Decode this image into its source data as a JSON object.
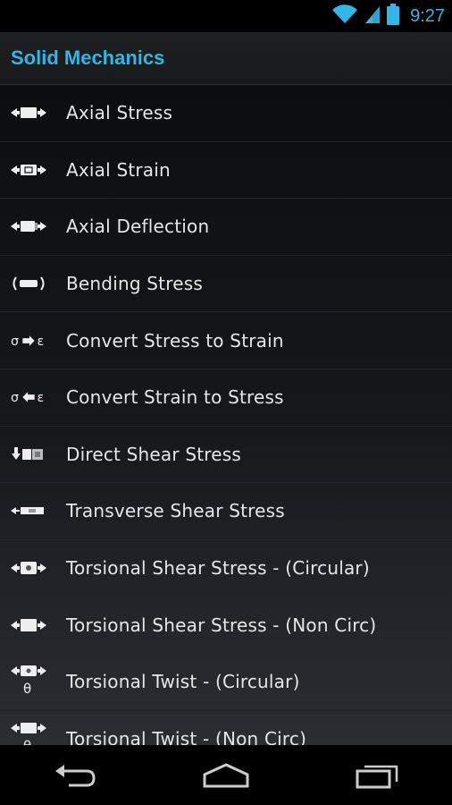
{
  "status": {
    "time": "9:27",
    "icons": [
      "wifi-icon",
      "cell-signal-icon",
      "battery-icon"
    ]
  },
  "app": {
    "title": "Solid Mechanics",
    "accent": "#33b5e5"
  },
  "list": [
    {
      "label": "Axial Stress",
      "icon": "axial-stress-icon"
    },
    {
      "label": "Axial Strain",
      "icon": "axial-strain-icon"
    },
    {
      "label": "Axial Deflection",
      "icon": "axial-deflection-icon"
    },
    {
      "label": "Bending Stress",
      "icon": "bending-stress-icon"
    },
    {
      "label": "Convert Stress to Strain",
      "icon": "stress-to-strain-icon",
      "glyph": "σ➔ε"
    },
    {
      "label": "Convert Strain to Stress",
      "icon": "strain-to-stress-icon",
      "glyph": "σ⬅ε"
    },
    {
      "label": "Direct Shear Stress",
      "icon": "direct-shear-icon"
    },
    {
      "label": "Transverse Shear Stress",
      "icon": "transverse-shear-icon"
    },
    {
      "label": "Torsional Shear Stress - (Circular)",
      "icon": "torsional-shear-circular-icon"
    },
    {
      "label": "Torsional Shear Stress - (Non Circ)",
      "icon": "torsional-shear-noncirc-icon"
    },
    {
      "label": "Torsional Twist - (Circular)",
      "icon": "torsional-twist-circular-icon",
      "glyph": "θ"
    },
    {
      "label": "Torsional Twist - (Non Circ)",
      "icon": "torsional-twist-noncirc-icon",
      "glyph": "θ"
    }
  ],
  "nav": [
    "back-icon",
    "home-icon",
    "recent-apps-icon"
  ]
}
